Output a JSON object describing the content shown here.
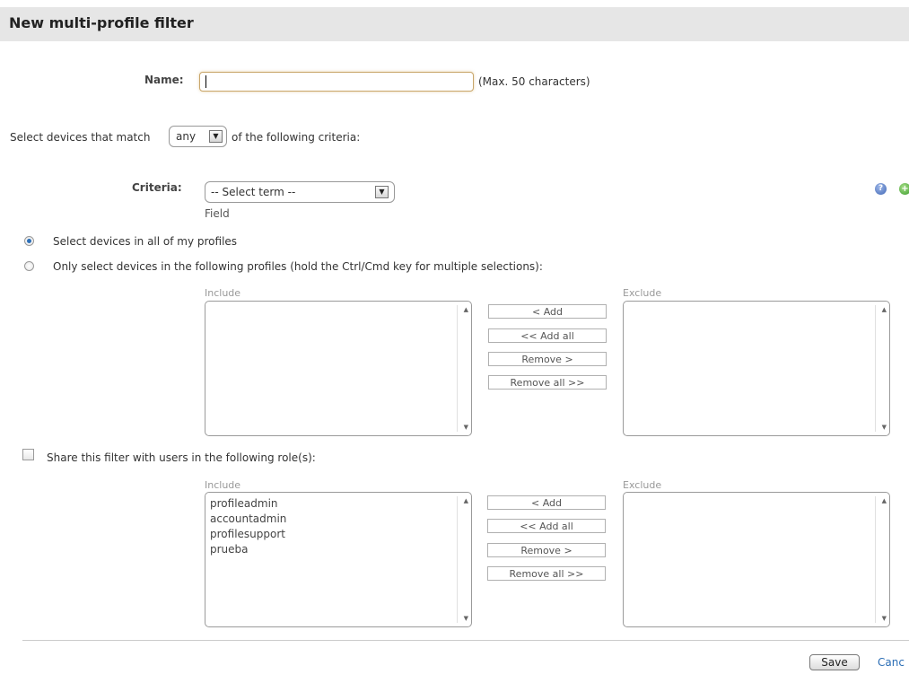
{
  "header": {
    "title": "New multi-profile filter"
  },
  "name_field": {
    "label": "Name:",
    "value": "",
    "hint": "(Max. 50 characters)"
  },
  "match": {
    "prefix": "Select devices that match",
    "selected": "any",
    "suffix": "of the following criteria:"
  },
  "criteria": {
    "label": "Criteria:",
    "selected": "-- Select term --",
    "sublabel": "Field"
  },
  "profiles": {
    "option_all": "Select devices in all of my profiles",
    "option_all_checked": true,
    "option_some": "Only select devices in the following profiles (hold the Ctrl/Cmd key for multiple selections):",
    "option_some_checked": false,
    "include_caption": "Include",
    "exclude_caption": "Exclude",
    "include_items": [],
    "exclude_items": [],
    "buttons": {
      "add": "< Add",
      "add_all": "<< Add all",
      "remove": "Remove >",
      "remove_all": "Remove all >>"
    }
  },
  "share": {
    "label": "Share this filter with users in the following role(s):",
    "checked": false,
    "include_caption": "Include",
    "exclude_caption": "Exclude",
    "include_items": [
      "profileadmin",
      "accountadmin",
      "profilesupport",
      "prueba"
    ],
    "exclude_items": [],
    "buttons": {
      "add": "< Add",
      "add_all": "<< Add all",
      "remove": "Remove >",
      "remove_all": "Remove all >>"
    }
  },
  "actions": {
    "save": "Save",
    "cancel": "Canc"
  },
  "icons": {
    "help": "help-icon",
    "add": "add-circle-icon"
  },
  "colors": {
    "link": "#2a6db5",
    "header_bg": "#e6e6e6",
    "radio_dot": "#2c6fb8"
  }
}
